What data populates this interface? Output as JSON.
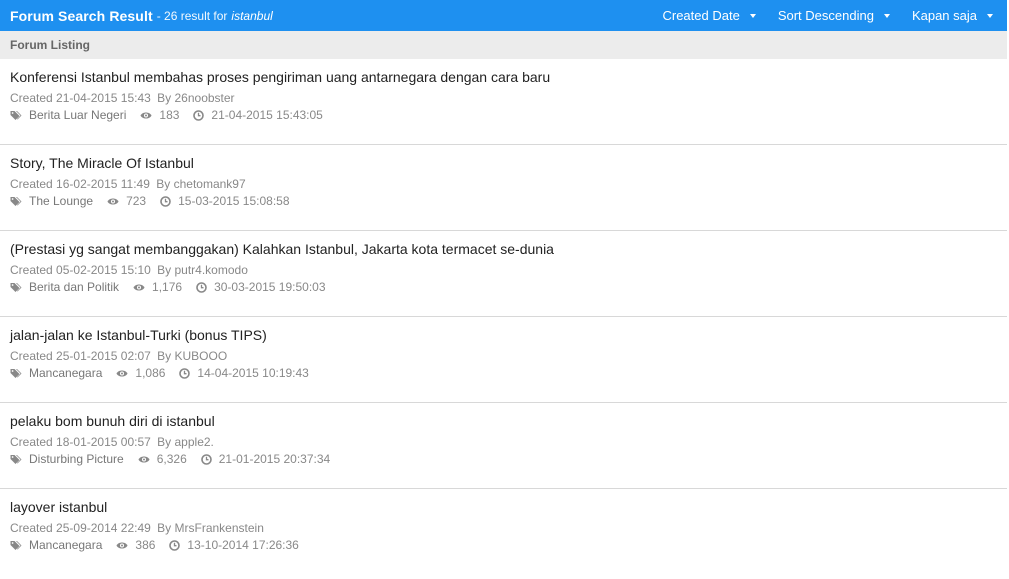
{
  "header": {
    "title": "Forum Search Result",
    "subtitle": "- 26 result for",
    "query": "istanbul",
    "filters": [
      {
        "label": "Created Date"
      },
      {
        "label": "Sort Descending"
      },
      {
        "label": "Kapan saja"
      }
    ],
    "colors": {
      "bar": "#1e90f0"
    }
  },
  "section": {
    "label": "Forum Listing"
  },
  "items": [
    {
      "title": "Konferensi Istanbul membahas proses pengiriman uang antarnegara dengan cara baru",
      "created_prefix": "Created",
      "created": "21-04-2015 15:43",
      "by_label": "By",
      "author": "26noobster",
      "category": "Berita Luar Negeri",
      "views": "183",
      "last_post": "21-04-2015 15:43:05"
    },
    {
      "title": "Story, The Miracle Of Istanbul",
      "created_prefix": "Created",
      "created": "16-02-2015 11:49",
      "by_label": "By",
      "author": "chetomank97",
      "category": "The Lounge",
      "views": "723",
      "last_post": "15-03-2015 15:08:58"
    },
    {
      "title": "(Prestasi yg sangat membanggakan) Kalahkan Istanbul, Jakarta kota termacet se-dunia",
      "created_prefix": "Created",
      "created": "05-02-2015 15:10",
      "by_label": "By",
      "author": "putr4.komodo",
      "category": "Berita dan Politik",
      "views": "1,176",
      "last_post": "30-03-2015 19:50:03"
    },
    {
      "title": "jalan-jalan ke Istanbul-Turki (bonus TIPS)",
      "created_prefix": "Created",
      "created": "25-01-2015 02:07",
      "by_label": "By",
      "author": "KUBOOO",
      "category": "Mancanegara",
      "views": "1,086",
      "last_post": "14-04-2015 10:19:43"
    },
    {
      "title": "pelaku bom bunuh diri di istanbul",
      "created_prefix": "Created",
      "created": "18-01-2015 00:57",
      "by_label": "By",
      "author": "apple2.",
      "category": "Disturbing Picture",
      "views": "6,326",
      "last_post": "21-01-2015 20:37:34"
    },
    {
      "title": "layover istanbul",
      "created_prefix": "Created",
      "created": "25-09-2014 22:49",
      "by_label": "By",
      "author": "MrsFrankenstein",
      "category": "Mancanegara",
      "views": "386",
      "last_post": "13-10-2014 17:26:36"
    }
  ],
  "icons": {
    "category": "tags-icon",
    "views": "eye-icon",
    "last_post": "clock-icon",
    "dropdown": "caret-down-icon"
  }
}
